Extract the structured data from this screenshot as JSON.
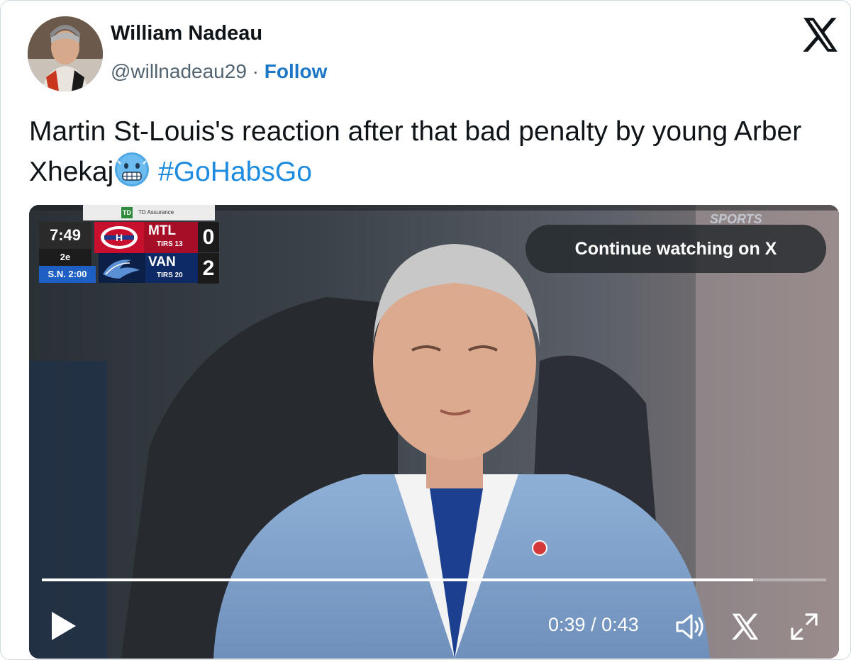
{
  "author": {
    "name": "William Nadeau",
    "handle": "@willnadeau29",
    "separator": "·",
    "follow_label": "Follow",
    "avatar_icon": "user-avatar-photo"
  },
  "tweet": {
    "text": "Martin St-Louis's reaction after that bad penalty by young Arber Xhekaj",
    "emoji_icon": "cold-face-emoji",
    "hashtag": "#GoHabsGo"
  },
  "brand_icon": "x-logo-icon",
  "video": {
    "continue_label": "Continue watching on X",
    "current_time": "0:39",
    "duration": "0:43",
    "time_separator": " / ",
    "progress_fraction": 0.907,
    "broadcaster_watermark": "SPORTS",
    "scoreboard": {
      "sponsor": "TD Assurance",
      "sponsor_logo": "TD",
      "clock": "7:49",
      "period": "2e",
      "power_play": "S.N. 2:00",
      "home": {
        "abbr": "MTL",
        "shots": "TIRS 13",
        "score": "0",
        "color": "#c8102e"
      },
      "away": {
        "abbr": "VAN",
        "shots": "TIRS 20",
        "score": "2",
        "color": "#0e2a66"
      }
    },
    "controls": {
      "play_icon": "play-icon",
      "volume_icon": "volume-icon",
      "x_icon": "x-logo-icon",
      "fullscreen_icon": "fullscreen-icon"
    }
  },
  "colors": {
    "link": "#1d77c7",
    "hashtag": "#1d8ce0",
    "text": "#0f1419",
    "muted": "#536471"
  }
}
